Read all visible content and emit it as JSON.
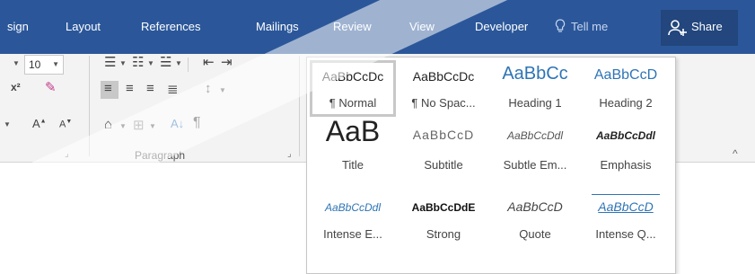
{
  "tabs": [
    "sign",
    "Layout",
    "References",
    "Mailings",
    "Review",
    "View",
    "Developer"
  ],
  "tell_me": "Tell me",
  "share": "Share",
  "font_size": "10",
  "paragraph_label": "Paragraph",
  "styles": [
    {
      "preview": "AaBbCcDc",
      "name": "¶ Normal"
    },
    {
      "preview": "AaBbCcDc",
      "name": "¶ No Spac..."
    },
    {
      "preview": "AaBbCc",
      "name": "Heading 1"
    },
    {
      "preview": "AaBbCcD",
      "name": "Heading 2"
    },
    {
      "preview": "AaB",
      "name": "Title"
    },
    {
      "preview": "AaBbCcD",
      "name": "Subtitle"
    },
    {
      "preview": "AaBbCcDdl",
      "name": "Subtle Em..."
    },
    {
      "preview": "AaBbCcDdl",
      "name": "Emphasis"
    },
    {
      "preview": "AaBbCcDdl",
      "name": "Intense E..."
    },
    {
      "preview": "AaBbCcDdE",
      "name": "Strong"
    },
    {
      "preview": "AaBbCcD",
      "name": "Quote"
    },
    {
      "preview": "AaBbCcD",
      "name": "Intense Q..."
    }
  ],
  "colors": {
    "ribbon_blue": "#2b579a",
    "heading_blue": "#2e74b5"
  }
}
